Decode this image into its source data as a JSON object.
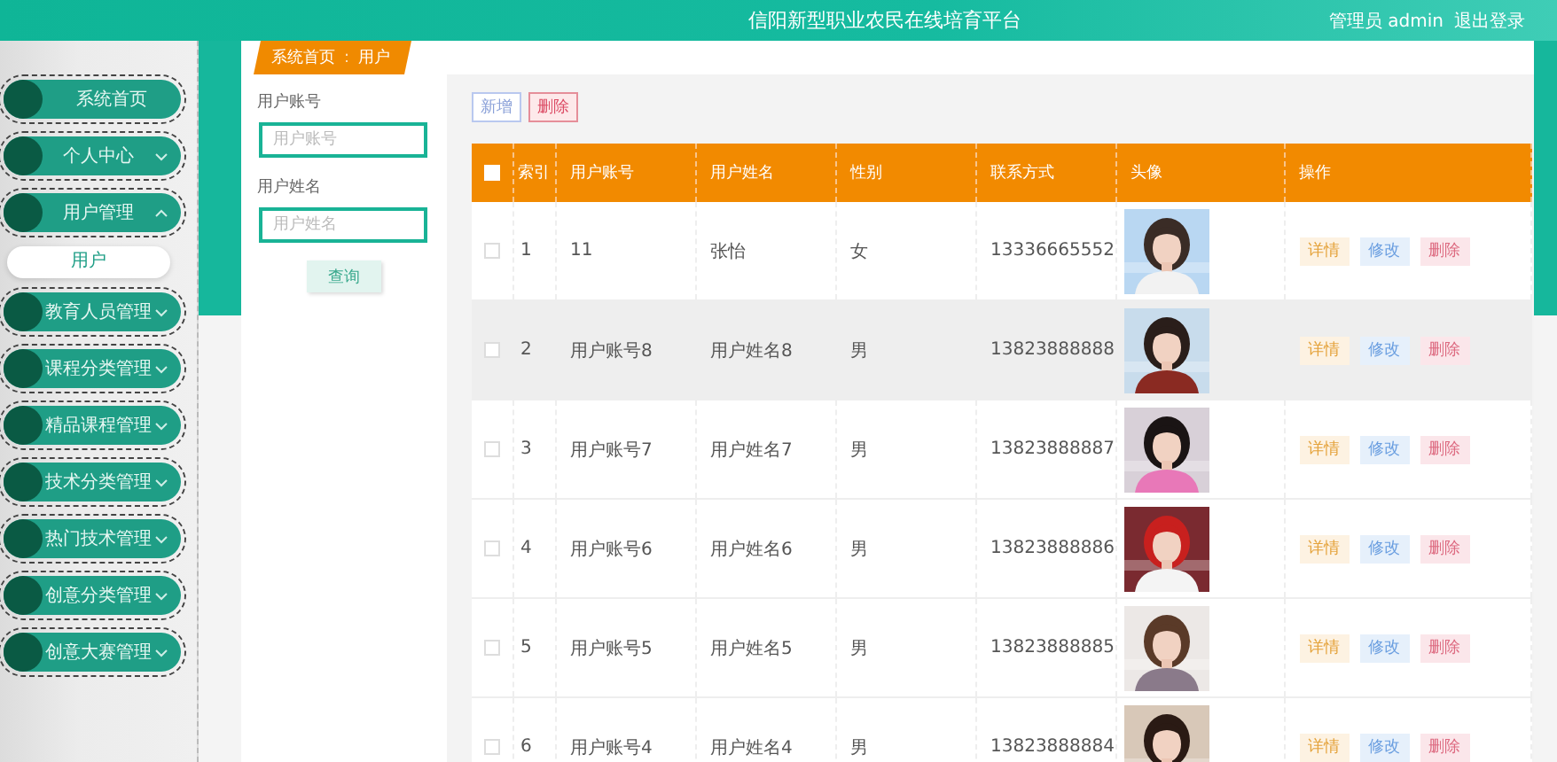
{
  "header": {
    "title": "信阳新型职业农民在线培育平台",
    "user": "管理员 admin",
    "logout": "退出登录"
  },
  "sidebar": {
    "items": [
      {
        "label": "系统首页"
      },
      {
        "label": "个人中心",
        "expanded": false
      },
      {
        "label": "用户管理",
        "expanded": true,
        "children": [
          {
            "label": "用户",
            "selected": true
          }
        ]
      },
      {
        "label": "教育人员管理",
        "expanded": false
      },
      {
        "label": "课程分类管理",
        "expanded": false
      },
      {
        "label": "精品课程管理",
        "expanded": false
      },
      {
        "label": "技术分类管理",
        "expanded": false
      },
      {
        "label": "热门技术管理",
        "expanded": false
      },
      {
        "label": "创意分类管理",
        "expanded": false
      },
      {
        "label": "创意大赛管理",
        "expanded": false
      }
    ]
  },
  "breadcrumb": {
    "home": "系统首页",
    "separator": "：",
    "current": "用户"
  },
  "search": {
    "fields": [
      {
        "label": "用户账号",
        "placeholder": "用户账号"
      },
      {
        "label": "用户姓名",
        "placeholder": "用户姓名"
      }
    ],
    "button": "查询"
  },
  "toolbar": {
    "buttons": [
      {
        "label": "新增",
        "kind": "add"
      },
      {
        "label": "删除",
        "kind": "delete"
      }
    ]
  },
  "table": {
    "header_checked": false,
    "columns": [
      "索引",
      "用户账号",
      "用户姓名",
      "性别",
      "联系方式",
      "头像",
      "操作"
    ],
    "rows": [
      {
        "checked": false,
        "highlighted": false,
        "index": "1",
        "account": "11",
        "name": "张怡",
        "gender": "女",
        "phone": "13336665552",
        "actions": [
          "详情",
          "修改",
          "删除"
        ]
      },
      {
        "checked": false,
        "highlighted": true,
        "index": "2",
        "account": "用户账号8",
        "name": "用户姓名8",
        "gender": "男",
        "phone": "13823888888",
        "actions": [
          "详情",
          "修改",
          "删除"
        ]
      },
      {
        "checked": false,
        "highlighted": false,
        "index": "3",
        "account": "用户账号7",
        "name": "用户姓名7",
        "gender": "男",
        "phone": "13823888887",
        "actions": [
          "详情",
          "修改",
          "删除"
        ]
      },
      {
        "checked": false,
        "highlighted": false,
        "index": "4",
        "account": "用户账号6",
        "name": "用户姓名6",
        "gender": "男",
        "phone": "13823888886",
        "actions": [
          "详情",
          "修改",
          "删除"
        ]
      },
      {
        "checked": false,
        "highlighted": false,
        "index": "5",
        "account": "用户账号5",
        "name": "用户姓名5",
        "gender": "男",
        "phone": "13823888885",
        "actions": [
          "详情",
          "修改",
          "删除"
        ]
      },
      {
        "checked": false,
        "highlighted": false,
        "index": "6",
        "account": "用户账号4",
        "name": "用户姓名4",
        "gender": "男",
        "phone": "13823888884",
        "actions": [
          "详情",
          "修改",
          "删除"
        ]
      }
    ]
  }
}
